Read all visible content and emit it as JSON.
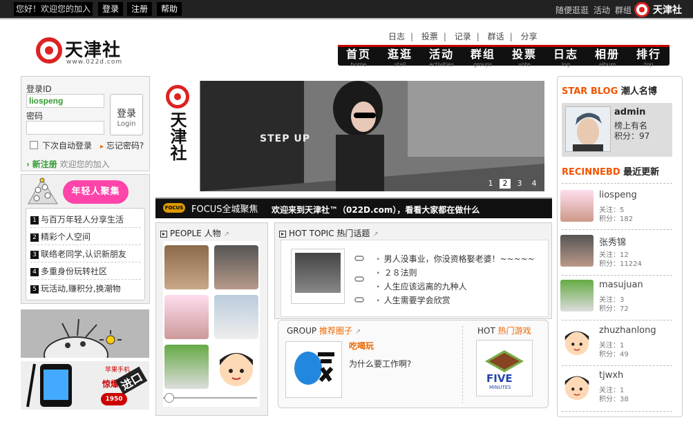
{
  "topbar": {
    "greeting": "您好！欢迎您的加入",
    "login": "登录",
    "register": "注册",
    "help": "帮助",
    "random": "随便逛逛",
    "activity": "活动",
    "group": "群组",
    "logo_text": "天津社"
  },
  "logo": {
    "name": "天津社",
    "url": "www.022d.com"
  },
  "top_links": [
    "日志",
    "投票",
    "记录",
    "群话",
    "分享"
  ],
  "nav": [
    {
      "zh": "首页",
      "en": "home"
    },
    {
      "zh": "逛逛",
      "en": "stall"
    },
    {
      "zh": "活动",
      "en": "activities"
    },
    {
      "zh": "群组",
      "en": "groups"
    },
    {
      "zh": "投票",
      "en": "vote"
    },
    {
      "zh": "日志",
      "en": "log"
    },
    {
      "zh": "相册",
      "en": "album"
    },
    {
      "zh": "排行",
      "en": "top"
    }
  ],
  "login": {
    "id_label": "登录ID",
    "id_value": "liospeng",
    "pwd_label": "密码",
    "btn_zh": "登录",
    "btn_en": "Login",
    "auto": "下次自动登录",
    "forgot": "忘记密码?",
    "register": "新注册",
    "welcome": "欢迎您的加入"
  },
  "youth": {
    "banner": "年轻人聚集",
    "items": [
      {
        "n": "1",
        "text": "与百万年轻人分享生活"
      },
      {
        "n": "2",
        "text": "精彩个人空间"
      },
      {
        "n": "3",
        "text": "联络老同学,认识新朋友"
      },
      {
        "n": "4",
        "text": "多重身份玩转社区"
      },
      {
        "n": "5",
        "text": "玩活动,赚积分,换潮物"
      }
    ]
  },
  "ad2": {
    "title": "苹果手机",
    "price_label": "惊爆价",
    "price": "1950",
    "enter": "进口"
  },
  "hero": {
    "side_text": "天津社",
    "pages": [
      "1",
      "2",
      "3",
      "4"
    ],
    "active_page": "2",
    "sign": "STEP UP"
  },
  "focus": {
    "tag": "FOCUS",
    "title": "FOCUS全城聚焦",
    "message": "欢迎来到天津社™（022D.com），看看大家都在做什么"
  },
  "people": {
    "title": "PEOPLE 人物"
  },
  "hot_topic": {
    "title": "HOT TOPIC 热门话题",
    "items": [
      "男人没事业，你没资格娶老婆！~~~~~",
      "２８法则",
      "人生应该远离的九种人",
      "人生需要学会欣赏"
    ]
  },
  "group": {
    "label": "GROUP",
    "label_zh": "推荐圈子",
    "name": "吃喝玩",
    "desc": "为什么要工作啊?"
  },
  "hot_game": {
    "label": "HOT",
    "label_zh": "热门游戏",
    "game_name": "FIVE",
    "game_sub": "MINUTES"
  },
  "star_blog": {
    "title_en": "STAR BLOG",
    "title_zh": "潮人名博",
    "name": "admin",
    "line2": "榜上有名",
    "line3": "积分：97"
  },
  "recent": {
    "title_en": "RECINNEBD",
    "title_zh": "最近更新",
    "users": [
      {
        "name": "liospeng",
        "follow": "关注：5",
        "score": "积分：182"
      },
      {
        "name": "张秀锦",
        "follow": "关注：12",
        "score": "积分：11224"
      },
      {
        "name": "masujuan",
        "follow": "关注：3",
        "score": "积分：72"
      },
      {
        "name": "zhuzhanlong",
        "follow": "关注：1",
        "score": "积分：49"
      },
      {
        "name": "tjwxh",
        "follow": "关注：1",
        "score": "积分：38"
      }
    ]
  },
  "colors": {
    "accent": "#dd2222",
    "orange": "#ee6600",
    "green": "#339933",
    "nav_bg": "#111111"
  }
}
